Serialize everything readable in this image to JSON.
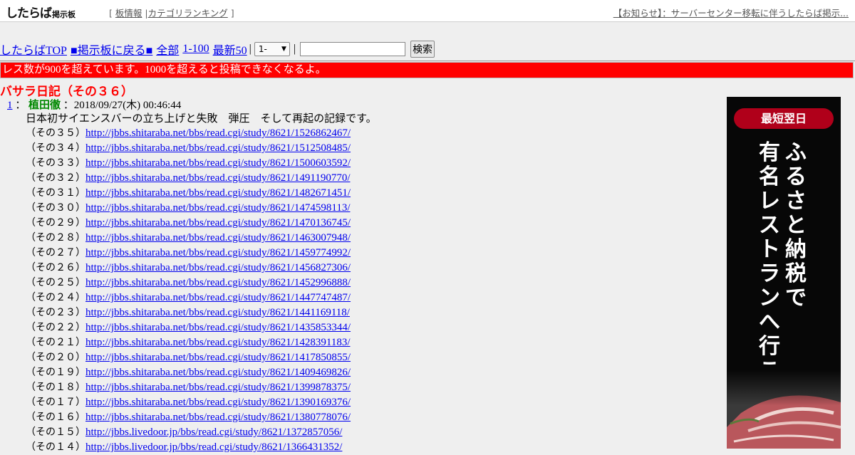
{
  "header": {
    "logo": "したらば",
    "logo_sub": "掲示板",
    "nav_open": "[",
    "nav_board_info": "板情報",
    "nav_sep": "|",
    "nav_category_ranking": "カテゴリランキング",
    "nav_close": "]",
    "notice": "【お知らせ】：サーバーセンター移転に伴うしたらば掲示..."
  },
  "nav": {
    "top": "したらばTOP",
    "back": "■掲示板に戻る■",
    "all": "全部",
    "range": "1-100",
    "latest": "最新50",
    "sep": "|",
    "select_value": "1-",
    "search_value": "",
    "search_button": "検索"
  },
  "warning": "レス数が900を超えています。1000を超えると投稿できなくなるよ。",
  "thread_title": "バサラ日記（その３６）",
  "post": {
    "number": "1",
    "colon": "：",
    "name": "植田徹",
    "colon2": "：",
    "date": "2018/09/27(木) 00:46:44",
    "intro": "日本初サイエンスバーの立ち上げと失敗　弾圧　そして再起の記録です。",
    "links": [
      {
        "label": "（その３５）",
        "url": "http://jbbs.shitaraba.net/bbs/read.cgi/study/8621/1526862467/"
      },
      {
        "label": "（その３４）",
        "url": "http://jbbs.shitaraba.net/bbs/read.cgi/study/8621/1512508485/"
      },
      {
        "label": "（その３３）",
        "url": "http://jbbs.shitaraba.net/bbs/read.cgi/study/8621/1500603592/"
      },
      {
        "label": "（その３２）",
        "url": "http://jbbs.shitaraba.net/bbs/read.cgi/study/8621/1491190770/"
      },
      {
        "label": "（その３１）",
        "url": "http://jbbs.shitaraba.net/bbs/read.cgi/study/8621/1482671451/"
      },
      {
        "label": "（その３０）",
        "url": "http://jbbs.shitaraba.net/bbs/read.cgi/study/8621/1474598113/"
      },
      {
        "label": "（その２９）",
        "url": "http://jbbs.shitaraba.net/bbs/read.cgi/study/8621/1470136745/"
      },
      {
        "label": "（その２８）",
        "url": "http://jbbs.shitaraba.net/bbs/read.cgi/study/8621/1463007948/"
      },
      {
        "label": "（その２７）",
        "url": "http://jbbs.shitaraba.net/bbs/read.cgi/study/8621/1459774992/"
      },
      {
        "label": "（その２６）",
        "url": "http://jbbs.shitaraba.net/bbs/read.cgi/study/8621/1456827306/"
      },
      {
        "label": "（その２５）",
        "url": "http://jbbs.shitaraba.net/bbs/read.cgi/study/8621/1452996888/"
      },
      {
        "label": "（その２４）",
        "url": "http://jbbs.shitaraba.net/bbs/read.cgi/study/8621/1447747487/"
      },
      {
        "label": "（その２３）",
        "url": "http://jbbs.shitaraba.net/bbs/read.cgi/study/8621/1441169118/"
      },
      {
        "label": "（その２２）",
        "url": "http://jbbs.shitaraba.net/bbs/read.cgi/study/8621/1435853344/"
      },
      {
        "label": "（その２１）",
        "url": "http://jbbs.shitaraba.net/bbs/read.cgi/study/8621/1428391183/"
      },
      {
        "label": "（その２０）",
        "url": "http://jbbs.shitaraba.net/bbs/read.cgi/study/8621/1417850855/"
      },
      {
        "label": "（その１９）",
        "url": "http://jbbs.shitaraba.net/bbs/read.cgi/study/8621/1409469826/"
      },
      {
        "label": "（その１８）",
        "url": "http://jbbs.shitaraba.net/bbs/read.cgi/study/8621/1399878375/"
      },
      {
        "label": "（その１７）",
        "url": "http://jbbs.shitaraba.net/bbs/read.cgi/study/8621/1390169376/"
      },
      {
        "label": "（その１６）",
        "url": "http://jbbs.shitaraba.net/bbs/read.cgi/study/8621/1380778076/"
      },
      {
        "label": "（その１５）",
        "url": "http://jbbs.livedoor.jp/bbs/read.cgi/study/8621/1372857056/"
      },
      {
        "label": "（その１４）",
        "url": "http://jbbs.livedoor.jp/bbs/read.cgi/study/8621/1366431352/"
      }
    ]
  },
  "ad": {
    "badge": "最短翌日",
    "line1": "ふるさと納税で",
    "line2": "有名レストランへ行こう",
    "colors": {
      "background": "#070707",
      "badge": "#b0001a",
      "text": "#ffffff"
    }
  },
  "colors": {
    "background": "#efefef",
    "link": "#0000ee",
    "warning_bg": "#ff0000",
    "title": "#ff0000",
    "name": "#008800"
  }
}
